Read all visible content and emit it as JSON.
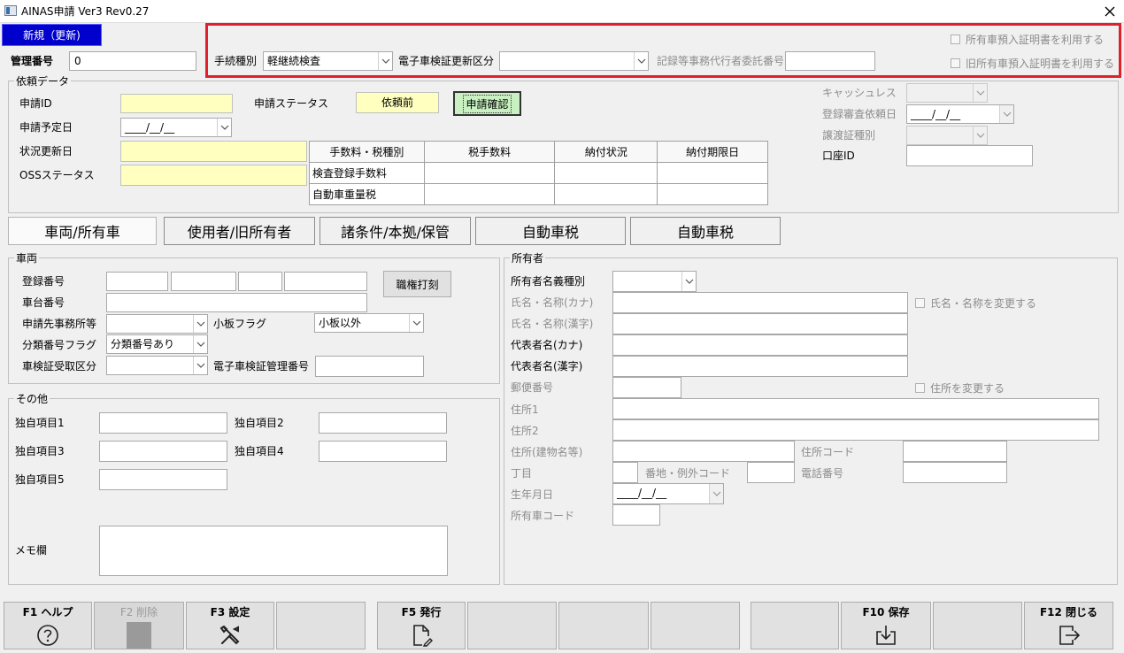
{
  "window": {
    "title": "AINAS申請 Ver3 Rev0.27",
    "close": "✕"
  },
  "mode_badge": "新規（更新)",
  "management_no": {
    "label": "管理番号",
    "value": "0"
  },
  "header": {
    "procedure_type": {
      "label": "手続種別",
      "value": "軽継続検査"
    },
    "ecert_update": {
      "label": "電子車検証更新区分",
      "value": ""
    },
    "agent_no": {
      "label": "記録等事務代行者委託番号",
      "value": ""
    },
    "chk_owner_cert": "所有車預入証明書を利用する",
    "chk_old_owner_cert": "旧所有車預入証明書を利用する"
  },
  "request": {
    "group_title": "依頼データ",
    "app_id_label": "申請ID",
    "app_id": "",
    "status_label": "申請ステータス",
    "status_value": "依頼前",
    "confirm_btn": "申請確認",
    "planned_date_label": "申請予定日",
    "planned_date": "____/__/__",
    "updated_label": "状況更新日",
    "oss_label": "OSSステータス",
    "fee_table": {
      "headers": [
        "手数料・税種別",
        "税手数料",
        "納付状況",
        "納付期限日"
      ],
      "rows": [
        [
          "検査登録手数料",
          "",
          "",
          ""
        ],
        [
          "自動車重量税",
          "",
          "",
          ""
        ]
      ]
    },
    "cashless_label": "キャッシュレス",
    "review_date_label": "登録審査依頼日",
    "review_date": "____/__/__",
    "transfer_label": "譲渡証種別",
    "account_label": "口座ID"
  },
  "tabs": [
    "車両/所有車",
    "使用者/旧所有者",
    "諸条件/本拠/保管",
    "自動車税",
    "自動車税"
  ],
  "vehicle": {
    "group_title": "車両",
    "reg_no_label": "登録番号",
    "chassis_label": "車台番号",
    "office_label": "申請先事務所等",
    "small_plate_label": "小板フラグ",
    "small_plate_value": "小板以外",
    "class_flag_label": "分類番号フラグ",
    "class_flag_value": "分類番号あり",
    "cert_recv_label": "車検証受取区分",
    "ecert_mgmt_label": "電子車検証管理番号",
    "stamp_btn": "職権打刻"
  },
  "other": {
    "group_title": "その他",
    "item1": "独自項目1",
    "item2": "独自項目2",
    "item3": "独自項目3",
    "item4": "独自項目4",
    "item5": "独自項目5",
    "memo": "メモ欄"
  },
  "owner": {
    "group_title": "所有者",
    "name_type": "所有者名義種別",
    "name_kana": "氏名・名称(カナ)",
    "name_kanji": "氏名・名称(漢字)",
    "rep_kana": "代表者名(カナ)",
    "rep_kanji": "代表者名(漢字)",
    "zip": "郵便番号",
    "addr1": "住所1",
    "addr2": "住所2",
    "addr_bldg": "住所(建物名等)",
    "chome": "丁目",
    "banchi": "番地・例外コード",
    "addr_code": "住所コード",
    "phone": "電話番号",
    "birth": "生年月日",
    "birth_value": "____/__/__",
    "owner_car_code": "所有車コード",
    "chk_change_name": "氏名・名称を変更する",
    "chk_change_addr": "住所を変更する"
  },
  "fkeys": {
    "f1": "F1 ヘルプ",
    "f2": "F2 削除",
    "f3": "F3 設定",
    "f5": "F5 発行",
    "f10": "F10 保存",
    "f12": "F12 閉じる"
  },
  "icons": [
    "app-icon",
    "close-icon",
    "dropdown-arrow-icon",
    "help-icon",
    "delete-icon",
    "settings-icon",
    "issue-document-icon",
    "save-icon",
    "exit-icon"
  ],
  "colors": {
    "accent": "#0000cc",
    "highlight_red": "#e0202a",
    "yellow_field": "#ffffc0",
    "confirm_green": "#c8f0c0"
  }
}
